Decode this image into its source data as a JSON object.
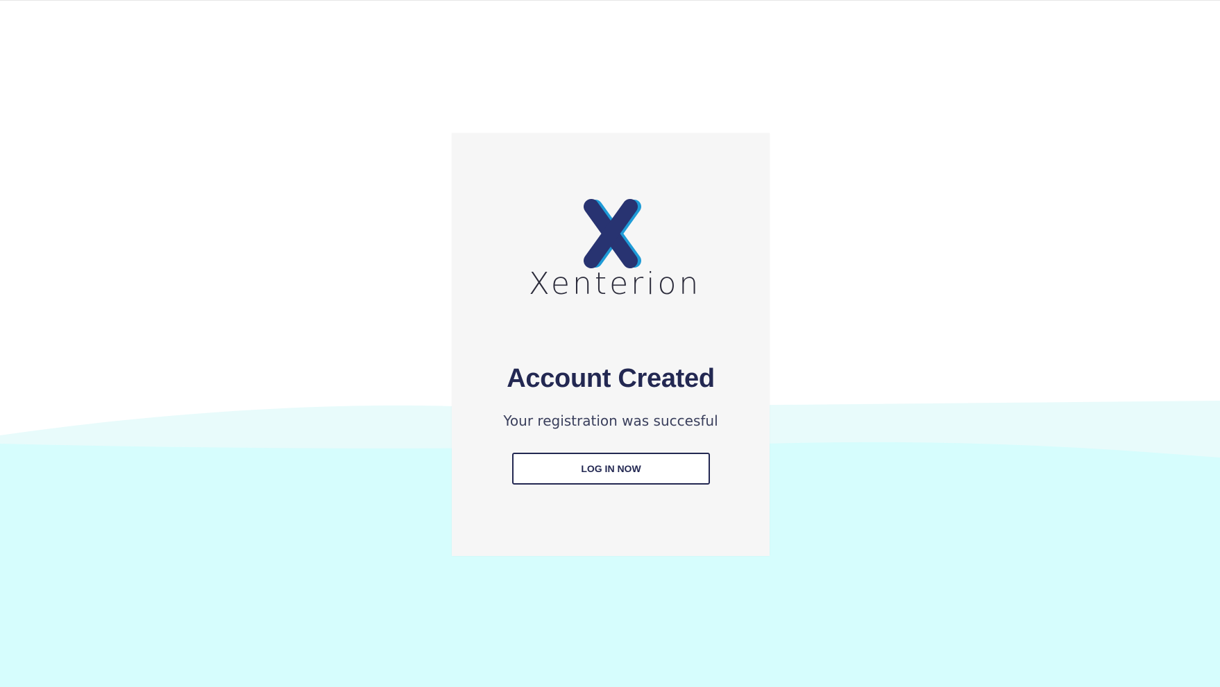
{
  "brand": {
    "name": "Xenterion",
    "logo_icon": "xenterion-x-logo-icon",
    "colors": {
      "navy": "#283371",
      "blue": "#1e9bd7"
    }
  },
  "card": {
    "title": "Account Created",
    "message": "Your registration was succesful",
    "login_button_label": "LOG IN NOW"
  },
  "theme": {
    "accent": "#232852",
    "card_background": "#f6f6f6",
    "wave_light": "#e8fbfb",
    "wave_main": "#d6fdfd"
  }
}
